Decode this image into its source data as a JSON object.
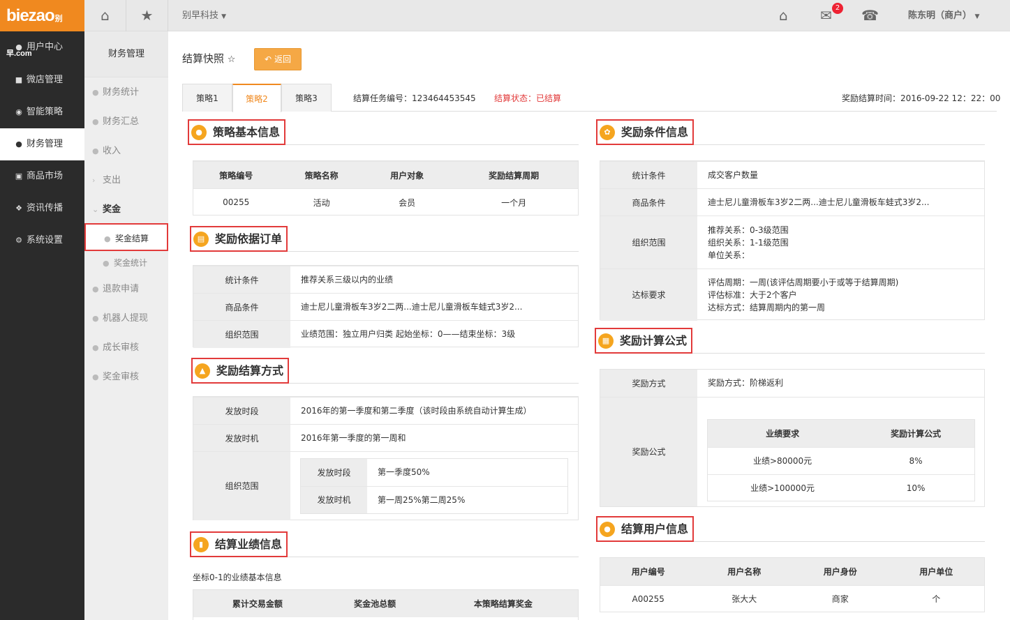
{
  "logo": {
    "text": "biezao",
    "sub": "别早.com"
  },
  "nav": [
    {
      "icon": "user-icon",
      "label": "用户中心",
      "active": false
    },
    {
      "icon": "shop-icon",
      "label": "微店管理",
      "active": false
    },
    {
      "icon": "strategy-icon",
      "label": "智能策略",
      "active": false
    },
    {
      "icon": "money-bag-icon",
      "label": "财务管理",
      "active": true
    },
    {
      "icon": "store-icon",
      "label": "商品市场",
      "active": false
    },
    {
      "icon": "grid-icon",
      "label": "资讯传播",
      "active": false
    },
    {
      "icon": "gear-icon",
      "label": "系统设置",
      "active": false
    }
  ],
  "topbar": {
    "company": "别早科技",
    "badge": "2",
    "user": "陈东明（商户）"
  },
  "submenu": {
    "title": "财务管理",
    "items": [
      "财务统计",
      "财务汇总",
      "收入",
      "支出",
      "奖金",
      "奖金结算",
      "奖金统计",
      "退款申请",
      "机器人提现",
      "成长审核",
      "奖金审核"
    ]
  },
  "page": {
    "title": "结算快照",
    "back": "返回"
  },
  "tabs": [
    "策略1",
    "策略2",
    "策略3"
  ],
  "meta": {
    "task_no": "结算任务编号：123464453545",
    "status": "结算状态：已结算",
    "time": "奖励结算时间：2016-09-22 12：22：00"
  },
  "basic": {
    "title": "策略基本信息",
    "headers": [
      "策略编号",
      "策略名称",
      "用户对象",
      "奖励结算周期"
    ],
    "row": [
      "00255",
      "活动",
      "会员",
      "一个月"
    ]
  },
  "orders": {
    "title": "奖励依据订单",
    "rows": [
      {
        "k": "统计条件",
        "v": "推荐关系三级以内的业绩"
      },
      {
        "k": "商品条件",
        "v": "迪士尼儿童滑板车3岁2二两...迪士尼儿童滑板车蛙式3岁2..."
      },
      {
        "k": "组织范围",
        "v": "业绩范围：独立用户归类 起始坐标：0——结束坐标：3级"
      }
    ]
  },
  "settle": {
    "title": "奖励结算方式",
    "rows": [
      {
        "k": "发放时段",
        "v": "2016年的第一季度和第二季度（该时段由系统自动计算生成）"
      },
      {
        "k": "发放时机",
        "v": "2016年第一季度的第一周和"
      }
    ],
    "org_label": "组织范围",
    "inner": [
      {
        "k": "发放时段",
        "v": "第一季度50%"
      },
      {
        "k": "发放时机",
        "v": "第一周25%第二周25%"
      }
    ]
  },
  "perf": {
    "title": "结算业绩信息",
    "note": "坐标0-1的业绩基本信息",
    "headers": [
      "累计交易金额",
      "奖金池总额",
      "本策略结算奖金"
    ]
  },
  "cond": {
    "title": "奖励条件信息",
    "rows": [
      {
        "k": "统计条件",
        "lines": [
          "成交客户数量"
        ]
      },
      {
        "k": "商品条件",
        "lines": [
          "迪士尼儿童滑板车3岁2二两...迪士尼儿童滑板车蛙式3岁2..."
        ]
      },
      {
        "k": "组织范围",
        "lines": [
          "推荐关系：0-3级范围",
          "组织关系：1-1级范围",
          "单位关系："
        ]
      },
      {
        "k": "达标要求",
        "lines": [
          "评估周期：一周(该评估周期要小于或等于结算周期)",
          "评估标准：大于2个客户",
          "达标方式：结算周期内的第一周"
        ]
      }
    ]
  },
  "formula": {
    "title": "奖励计算公式",
    "mode_k": "奖励方式",
    "mode_v": "奖励方式：阶梯返利",
    "formula_k": "奖励公式",
    "headers": [
      "业绩要求",
      "奖励计算公式"
    ],
    "rows": [
      [
        "业绩>80000元",
        "8%"
      ],
      [
        "业绩>100000元",
        "10%"
      ]
    ]
  },
  "users": {
    "title": "结算用户信息",
    "headers": [
      "用户编号",
      "用户名称",
      "用户身份",
      "用户单位"
    ],
    "row": [
      "A00255",
      "张大大",
      "商家",
      "个"
    ]
  }
}
